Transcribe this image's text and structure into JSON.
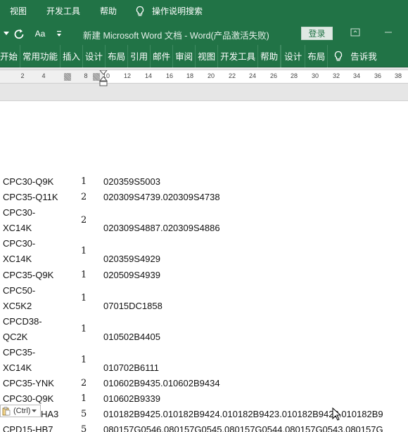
{
  "menubar": {
    "items": [
      "视图",
      "开发工具",
      "帮助"
    ],
    "tell_me": "操作说明搜索"
  },
  "titlebar": {
    "doc_title": "新建 Microsoft Word 文档  -  Word(产品激活失败)",
    "font_size_label": "Aa",
    "login_label": "登录"
  },
  "tabs": {
    "items": [
      "开始",
      "常用功能",
      "插入",
      "设计",
      "布局",
      "引用",
      "邮件",
      "审阅",
      "视图",
      "开发工具",
      "帮助"
    ],
    "contextual": [
      "设计",
      "布局"
    ],
    "tell_me": "告诉我"
  },
  "ruler": {
    "labels": [
      "2",
      "4",
      "8",
      "10",
      "12",
      "14",
      "16",
      "18",
      "20",
      "22",
      "24",
      "26",
      "28",
      "30",
      "32",
      "34",
      "36",
      "38"
    ]
  },
  "table": {
    "rows": [
      {
        "model": "CPC30-Q9K",
        "qty": "1",
        "serial": "020359S5003"
      },
      {
        "model": "CPC35-Q11K",
        "qty": "2",
        "serial": "020309S4739.020309S4738"
      },
      {
        "model_l1": "CPC30-",
        "model_l2": "XC14K",
        "qty": "2",
        "serial": "020309S4887.020309S4886"
      },
      {
        "model_l1": "CPC30-",
        "model_l2": "XC14K",
        "qty": "1",
        "serial": "020359S4929"
      },
      {
        "model": "CPC35-Q9K",
        "qty": "1",
        "serial": "020509S4939"
      },
      {
        "model_l1": "CPC50-",
        "model_l2": "XC5K2",
        "qty": "1",
        "serial": "07015DC1858"
      },
      {
        "model_l1": "CPCD38-",
        "model_l2": "QC2K",
        "qty": "1",
        "serial": "010502B4405"
      },
      {
        "model_l1": "CPC35-",
        "model_l2": "XC14K",
        "qty": "1",
        "serial": "010702B6111"
      },
      {
        "model": "CPC35-YNK",
        "qty": "2",
        "serial": "010602B9435.010602B9434"
      },
      {
        "model": "CPC30-Q9K",
        "qty": "1",
        "serial": "010602B9339"
      },
      {
        "model": "HA3",
        "qty": "5",
        "serial": "010182B9425.010182B9424.010182B9423.010182B9422.010182B9"
      },
      {
        "model": "CPD15-HB7",
        "qty": "5",
        "serial": "080157G0546.080157G0545.080157G0544.080157G0543.080157G"
      }
    ]
  },
  "paste_options": {
    "label": "(Ctrl)"
  },
  "colors": {
    "ribbon_green": "#217346",
    "text": "#111111"
  }
}
